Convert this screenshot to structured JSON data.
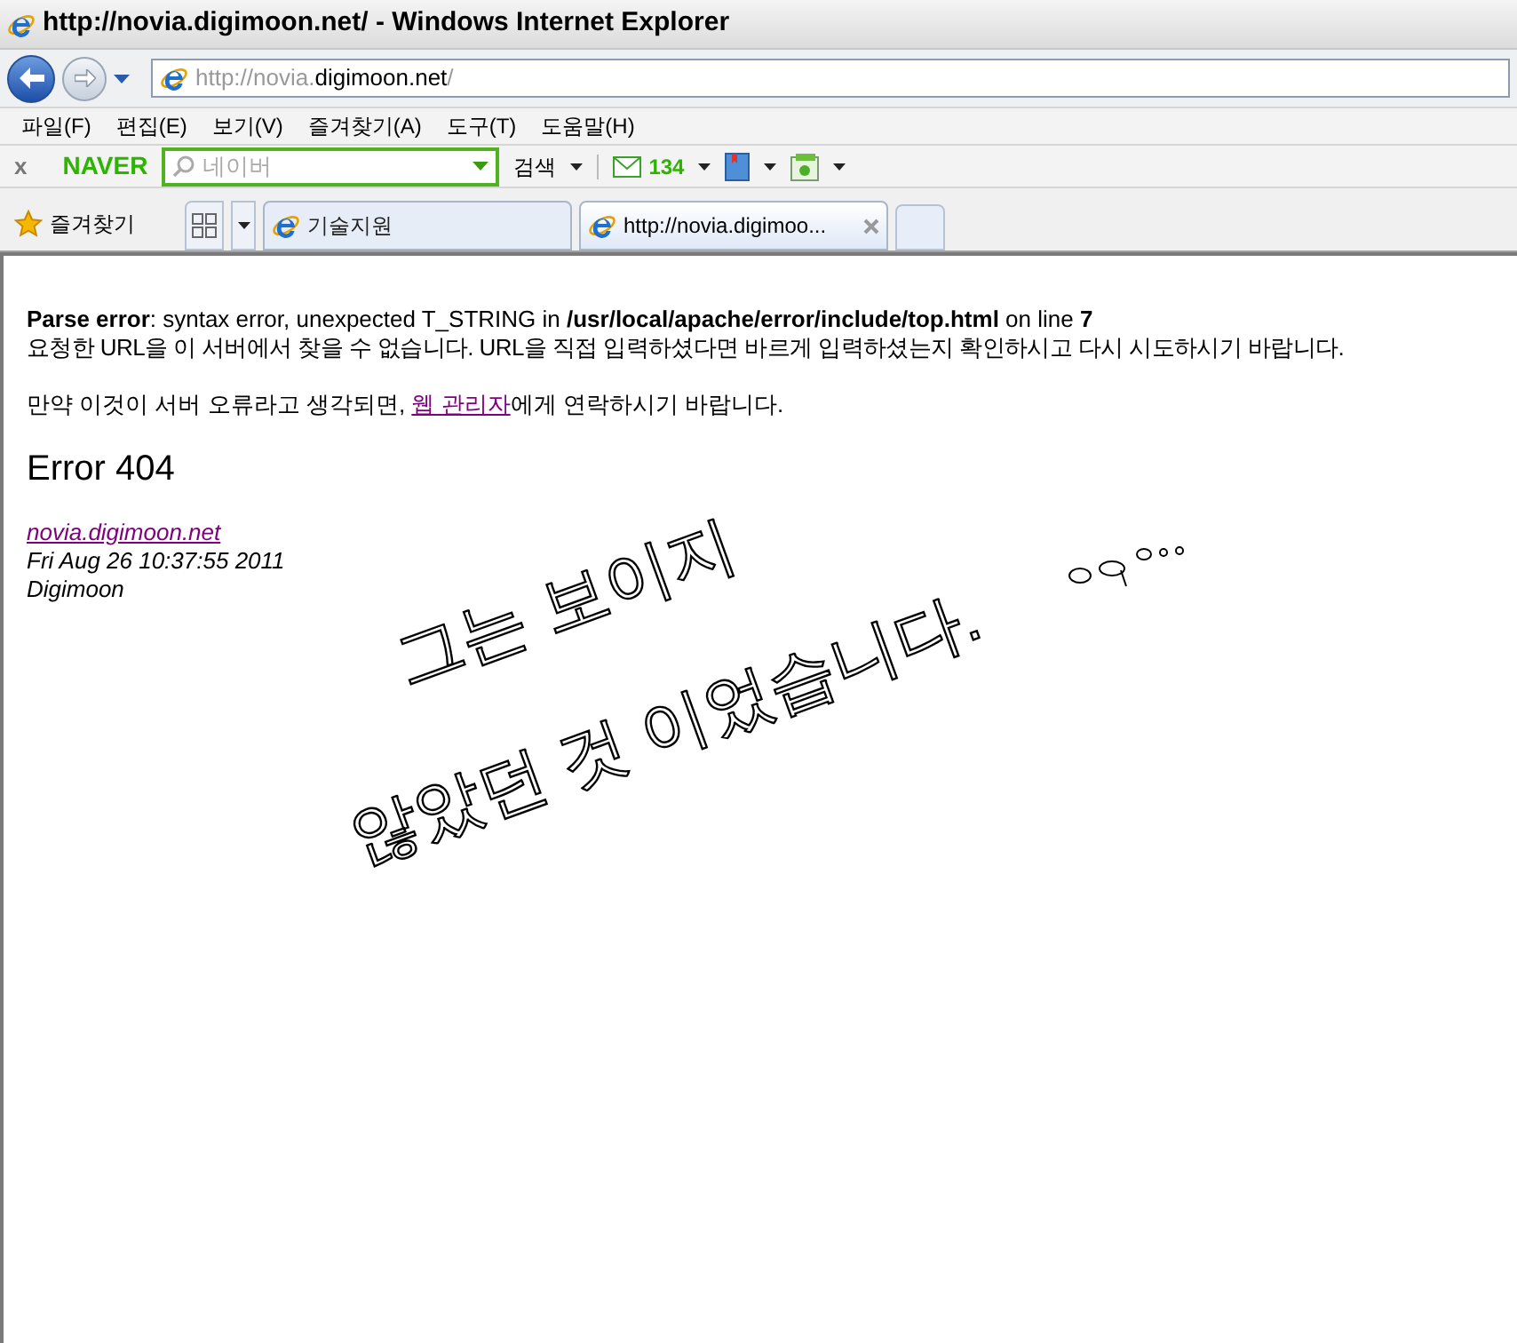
{
  "window": {
    "title": "http://novia.digimoon.net/ - Windows Internet Explorer"
  },
  "address_bar": {
    "url_parts": [
      {
        "text": "http://novia.",
        "emphasized": false
      },
      {
        "text": "digimoon.net",
        "emphasized": true
      },
      {
        "text": "/",
        "emphasized": false
      }
    ]
  },
  "menu": [
    "파일(F)",
    "편집(E)",
    "보기(V)",
    "즐겨찾기(A)",
    "도구(T)",
    "도움말(H)"
  ],
  "naver_toolbar": {
    "close": "x",
    "logo": "NAVER",
    "search_placeholder": "네이버",
    "search_button": "검색",
    "mail_count": "134"
  },
  "favorites_button": "즐겨찾기",
  "tabs": [
    {
      "label": "기술지원",
      "selected": false
    },
    {
      "label": "http://novia.digimoo...",
      "selected": true
    }
  ],
  "content": {
    "parse_error": "**Parse error**: syntax error, unexpected T_STRING in **/usr/local/apache/error/include/top.html** on line **7**",
    "message": "요청한 URL을 이 서버에서 찾을 수 없습니다. URL을 직접 입력하셨다면 바르게 입력하셨는지 확인하시고 다시 시도하시기 바랍니다.",
    "contact_before": "만약 이것이 서버 오류라고 생각되면, ",
    "contact_link": "웹 관리자",
    "contact_after": "에게 연락하시기 바랍니다.",
    "heading": "Error 404",
    "server_link": "novia.digimoon.net",
    "timestamp": "Fri Aug 26 10:37:55 2011",
    "server_name": "Digimoon"
  },
  "handwritten_note": [
    "그는 보이지",
    "않았던 것 이었습니다."
  ]
}
